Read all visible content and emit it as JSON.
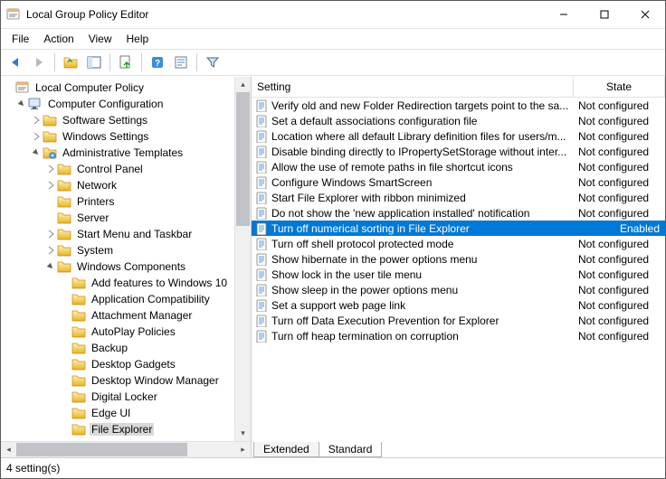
{
  "window": {
    "title": "Local Group Policy Editor"
  },
  "menu": {
    "file": "File",
    "action": "Action",
    "view": "View",
    "help": "Help"
  },
  "tree": {
    "root": "Local Computer Policy",
    "computer_config": "Computer Configuration",
    "software_settings": "Software Settings",
    "windows_settings": "Windows Settings",
    "admin_templates": "Administrative Templates",
    "control_panel": "Control Panel",
    "network": "Network",
    "printers": "Printers",
    "server": "Server",
    "start_menu": "Start Menu and Taskbar",
    "system": "System",
    "win_components": "Windows Components",
    "c0": "Add features to Windows 10",
    "c1": "Application Compatibility",
    "c2": "Attachment Manager",
    "c3": "AutoPlay Policies",
    "c4": "Backup",
    "c5": "Desktop Gadgets",
    "c6": "Desktop Window Manager",
    "c7": "Digital Locker",
    "c8": "Edge UI",
    "c9": "File Explorer"
  },
  "list": {
    "hdr_setting": "Setting",
    "hdr_state": "State",
    "state_nc": "Not configured",
    "state_en": "Enabled",
    "rows": {
      "r0": "Verify old and new Folder Redirection targets point to the sa...",
      "r1": "Set a default associations configuration file",
      "r2": "Location where all default Library definition files for users/m...",
      "r3": "Disable binding directly to IPropertySetStorage without inter...",
      "r4": "Allow the use of remote paths in file shortcut icons",
      "r5": "Configure Windows SmartScreen",
      "r6": "Start File Explorer with ribbon minimized",
      "r7": "Do not show the 'new application installed' notification",
      "r8": "Turn off numerical sorting in File Explorer",
      "r9": "Turn off shell protocol protected mode",
      "r10": "Show hibernate in the power options menu",
      "r11": "Show lock in the user tile menu",
      "r12": "Show sleep in the power options menu",
      "r13": "Set a support web page link",
      "r14": "Turn off Data Execution Prevention for Explorer",
      "r15": "Turn off heap termination on corruption"
    }
  },
  "tabs": {
    "extended": "Extended",
    "standard": "Standard"
  },
  "status": {
    "text": "4 setting(s)"
  }
}
